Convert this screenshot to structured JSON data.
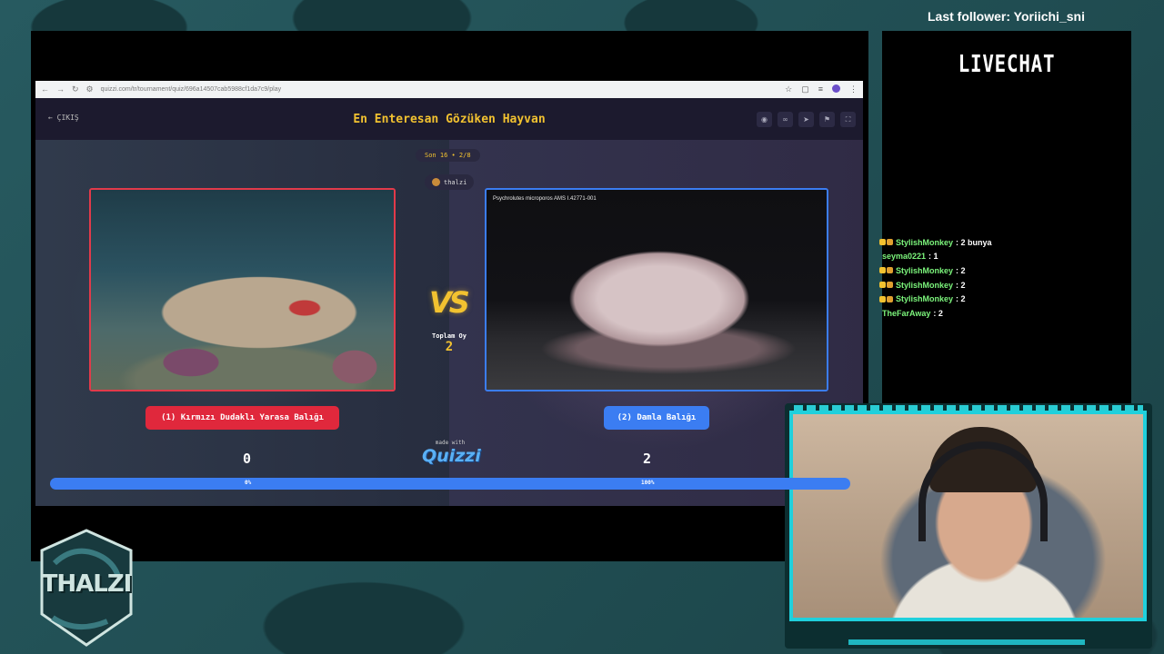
{
  "overlay": {
    "last_follower": "Last follower: Yoriichi_sni",
    "chat_title": "LIVECHAT",
    "logo_text": "THALZI"
  },
  "browser": {
    "url": "quizzi.com/tr/tournament/quiz/696a14507cab5988cf1da7c9/play",
    "nav_icons": [
      "back-icon",
      "forward-icon",
      "reload-icon",
      "site-info-icon"
    ],
    "tool_icons": [
      "bookmark-star-icon",
      "extensions-icon",
      "media-icon",
      "profile-icon"
    ]
  },
  "quiz": {
    "exit_label": "← ÇIKIŞ",
    "title": "En Enteresan Gözüken Hayvan",
    "header_tools": [
      "eye-icon",
      "link-icon",
      "share-icon",
      "flag-icon",
      "fullscreen-icon"
    ],
    "round": "Son 16 • 2/8",
    "host": "thalzi",
    "vs": "VS",
    "total_label": "Toplam Oy",
    "total_votes": "2",
    "made_with": "made with",
    "brand": "Quizzi",
    "left": {
      "button": "(1) Kırmızı Dudaklı Yarasa Balığı",
      "score": "0",
      "percent_label": "0%",
      "percent": 0,
      "color": "#e0283c"
    },
    "right": {
      "button": "(2) Damla Balığı",
      "score": "2",
      "percent_label": "100%",
      "percent": 100,
      "caption": "Psychrolutes microporos AMS I.42771-001",
      "color": "#3b7df2"
    },
    "accent": "#f2c230"
  },
  "chat": {
    "messages": [
      {
        "user": "StylishMonkey",
        "text": ": 2 bunya",
        "badges": true
      },
      {
        "user": "seyma0221",
        "text": ": 1",
        "badges": false
      },
      {
        "user": "StylishMonkey",
        "text": ": 2",
        "badges": true
      },
      {
        "user": "StylishMonkey",
        "text": ": 2",
        "badges": true
      },
      {
        "user": "StylishMonkey",
        "text": ": 2",
        "badges": true
      },
      {
        "user": "TheFarAway",
        "text": ": 2",
        "badges": false
      }
    ]
  }
}
